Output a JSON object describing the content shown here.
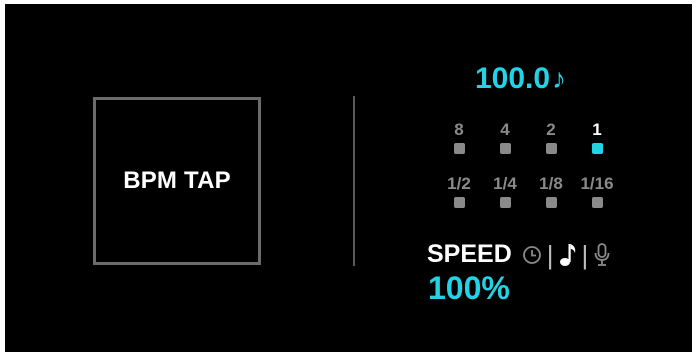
{
  "tap_button": {
    "label": "BPM TAP"
  },
  "bpm": {
    "value": "100.0",
    "unit_icon": "music-note-icon",
    "note_glyph": "♪"
  },
  "beat_divisions": {
    "row1": [
      {
        "label": "8",
        "active": false
      },
      {
        "label": "4",
        "active": false
      },
      {
        "label": "2",
        "active": false
      },
      {
        "label": "1",
        "active": true
      }
    ],
    "row2": [
      {
        "label": "1/2",
        "active": false
      },
      {
        "label": "1/4",
        "active": false
      },
      {
        "label": "1/8",
        "active": false
      },
      {
        "label": "1/16",
        "active": false
      }
    ]
  },
  "speed": {
    "label": "SPEED",
    "value": "100%",
    "modes": [
      {
        "icon": "clock-icon",
        "selected": false
      },
      {
        "icon": "music-note-icon",
        "selected": true
      },
      {
        "icon": "microphone-icon",
        "selected": false
      }
    ],
    "separator": "|"
  },
  "colors": {
    "accent": "#22d3e6",
    "inactive": "#8a8a8a",
    "active_text": "#ffffff",
    "border": "#6b6b6b",
    "background": "#000000"
  }
}
